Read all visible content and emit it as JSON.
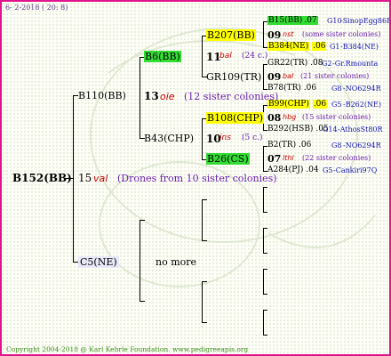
{
  "date": "6- 2-2018 ( 20: 8)",
  "copyright": "Copyright 2004-2018 @ Karl Kehrle Foundation.   www.pedigreeapis.org",
  "root": {
    "id": "B152(BB)",
    "gen": "15",
    "code": "val",
    "note": "(Drones from 10 sister colonies)",
    "mother": {
      "id": "B110(BB)",
      "gen": "13",
      "code": "oie",
      "note": "(12 sister colonies)",
      "mother": {
        "id": "B6(BB)",
        "gen": "11",
        "code": "bal",
        "note": "(24 c.)",
        "mother": {
          "id": "B207(BB)",
          "gen": "09",
          "code": "nst",
          "note": "(some sister colonies)",
          "mother": {
            "id": "B15(BB)",
            "val": ".07",
            "num": "G10",
            "name": "-SinopEgg86R"
          },
          "father": {
            "id": "B384(NE)",
            "val": ".06",
            "num": "G1",
            "name": "-B384(NE)"
          }
        },
        "father": {
          "id": "GR109(TR)",
          "gen": "09",
          "code": "bal",
          "note": "(21 sister colonies)",
          "mother": {
            "id": "GR22(TR)",
            "val": ".08",
            "num": "G2",
            "name": "-Gr.Rmounta"
          },
          "father": {
            "id": "B78(TR)",
            "val": ".06",
            "num": "G8",
            "name": "-NO6294R"
          }
        }
      },
      "father": {
        "id": "B43(CHP)",
        "gen": "10",
        "code": "ins",
        "note": "(5 c.)",
        "mother": {
          "id": "B108(CHP)",
          "gen": "08",
          "code": "hbg",
          "note": "(15 sister colonies)",
          "mother": {
            "id": "B99(CHP)",
            "val": ".06",
            "num": "G5",
            "name": "-B262(NE)"
          },
          "father": {
            "id": "B292(HSB)",
            "val": ".05",
            "num": "G14",
            "name": "-AthosSt80R"
          }
        },
        "father": {
          "id": "B26(CS)",
          "gen": "07",
          "code": "lthl",
          "note": "(22 sister colonies)",
          "mother": {
            "id": "B2(TR)",
            "val": ".06",
            "num": "G8",
            "name": "-NO6294R"
          },
          "father": {
            "id": "A284(PJ)",
            "val": ".04",
            "num": "G5",
            "name": "-Cankiri97Q"
          }
        }
      }
    },
    "father": {
      "id": "C5(NE)",
      "note": "no more"
    }
  },
  "colors": {
    "frame": "#e0148c",
    "highlight_green": "#33dd33",
    "highlight_yellow": "#ffff00",
    "code_red": "#cc0000",
    "note_purple": "#6a1fb0",
    "leaf_blue": "#1414b4",
    "copyright_green": "#3d8a1c"
  }
}
